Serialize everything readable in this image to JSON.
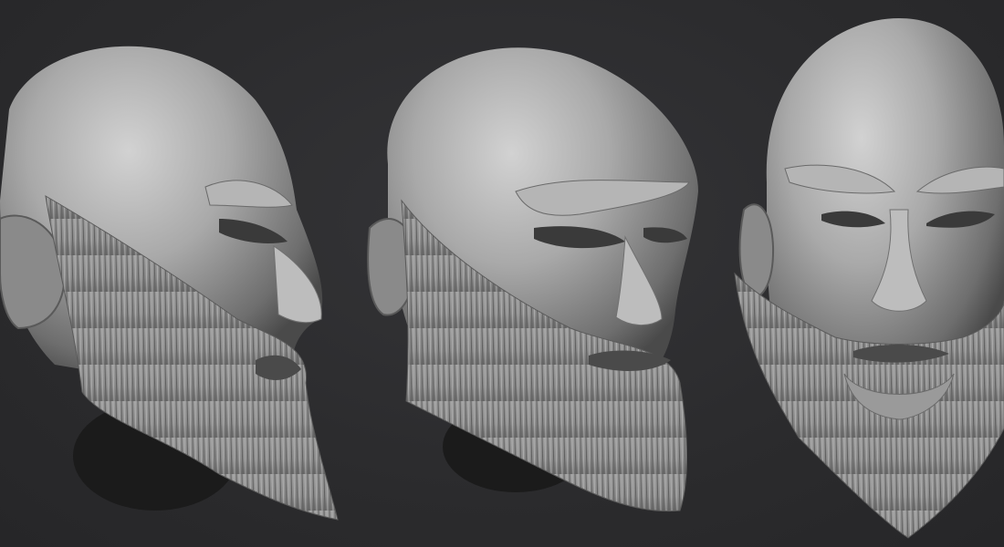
{
  "scene": {
    "background_color": "#2c2c2e",
    "material_color": "#9a9a9a",
    "views": [
      {
        "name": "left-profile",
        "angle": "side"
      },
      {
        "name": "three-quarter",
        "angle": "three-quarter"
      },
      {
        "name": "front",
        "angle": "front"
      }
    ]
  }
}
